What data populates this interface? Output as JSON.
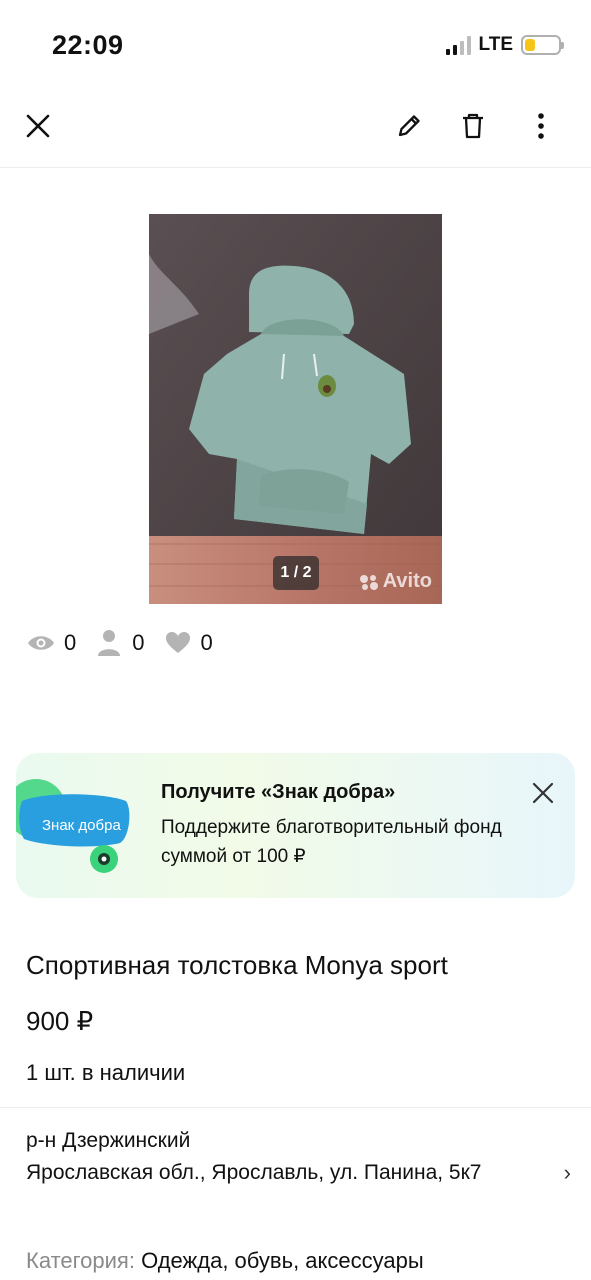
{
  "status": {
    "time": "22:09",
    "network": "LTE",
    "signal_bars": 4,
    "signal_active": 2,
    "battery_level": 0.3
  },
  "toolbar": {
    "close_icon": "close-icon",
    "edit_icon": "pencil-icon",
    "delete_icon": "trash-icon",
    "more_icon": "more-vertical-icon"
  },
  "gallery": {
    "counter": "1 / 2",
    "watermark": "Avito"
  },
  "stats": {
    "views": "0",
    "contacts": "0",
    "favorites": "0"
  },
  "promo": {
    "badge_text": "Знак добра",
    "title": "Получите «Знак добра»",
    "text": "Поддержите благотворительный фонд суммой от 100 ₽"
  },
  "listing": {
    "title": "Спортивная толстовка Monya sport",
    "price": "900 ₽",
    "stock": "1 шт. в наличии",
    "district": "р-н Дзержинский",
    "address": "Ярославская обл., Ярославль, ул. Панина, 5к7",
    "category_label": "Категория:",
    "category_value": "Одежда, обувь, аксессуары"
  },
  "colors": {
    "accent_green": "#2fd06a",
    "promo_blue": "#2a9fe0",
    "photo_bg": "#4d4447",
    "hoodie": "#8fb3aa"
  }
}
